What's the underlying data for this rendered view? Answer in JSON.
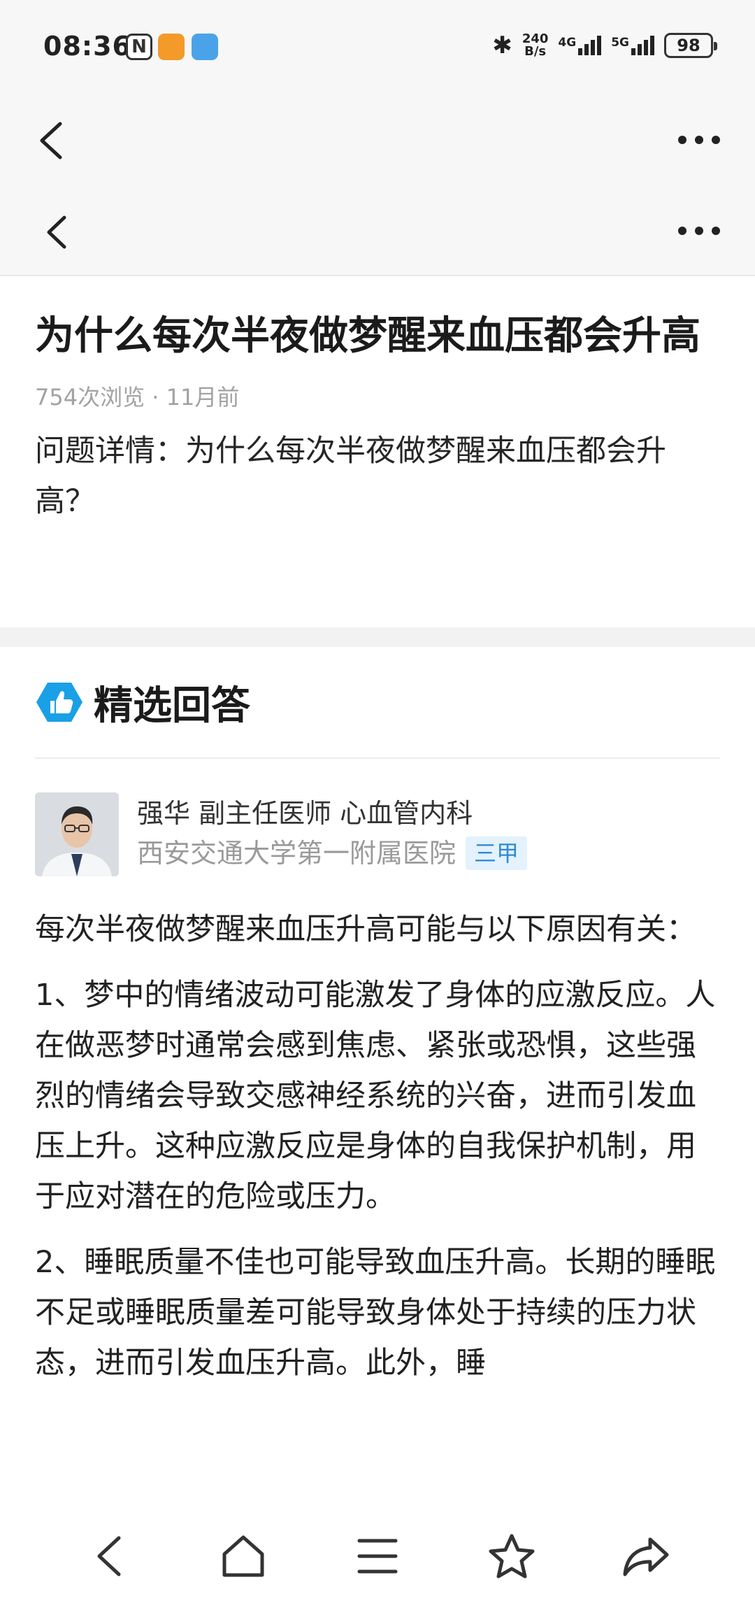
{
  "status_bar": {
    "time": "08:36",
    "nfc_glyph": "N",
    "speed_value": "240",
    "speed_unit": "B/s",
    "net1_label": "4G",
    "net2_label": "5G",
    "battery": "98",
    "bluetooth_glyph": "✱"
  },
  "nav": {
    "outer": {
      "back_icon": "chevron-left-icon",
      "more_icon": "more-dots-icon"
    },
    "inner": {
      "back_icon": "chevron-left-icon",
      "more_icon": "more-dots-icon"
    }
  },
  "question": {
    "title": "为什么每次半夜做梦醒来血压都会升高",
    "meta": "754次浏览 · 11月前",
    "detail": "问题详情：为什么每次半夜做梦醒来血压都会升高？"
  },
  "answers": {
    "section_title": "精选回答",
    "doctor": {
      "name_line": "强华 副主任医师 心血管内科",
      "hospital": "西安交通大学第一附属医院",
      "grade": "三甲"
    },
    "paragraphs": [
      "每次半夜做梦醒来血压升高可能与以下原因有关：",
      "1、梦中的情绪波动可能激发了身体的应激反应。人在做恶梦时通常会感到焦虑、紧张或恐惧，这些强烈的情绪会导致交感神经系统的兴奋，进而引发血压上升。这种应激反应是身体的自我保护机制，用于应对潜在的危险或压力。",
      "2、睡眠质量不佳也可能导致血压升高。长期的睡眠不足或睡眠质量差可能导致身体处于持续的压力状态，进而引发血压升高。此外，睡"
    ]
  },
  "bottom_nav": [
    {
      "name": "back",
      "icon": "chevron-left-icon"
    },
    {
      "name": "home",
      "icon": "home-icon"
    },
    {
      "name": "menu",
      "icon": "menu-icon"
    },
    {
      "name": "favorite",
      "icon": "star-icon"
    },
    {
      "name": "share",
      "icon": "share-icon"
    }
  ],
  "colors": {
    "accent_blue": "#2f8ad6",
    "grade_bg": "#e3f2fc",
    "meta_gray": "#a2a2a2",
    "badge_blue": "#1aa0e6"
  }
}
